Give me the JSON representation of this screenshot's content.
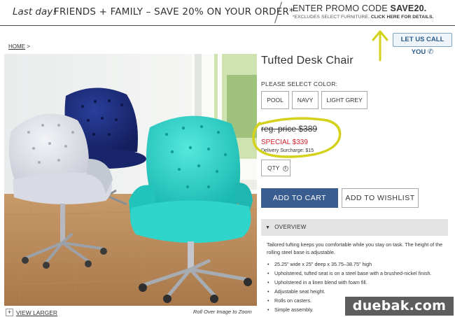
{
  "banner": {
    "last_day": "Last day!",
    "offer": "FRIENDS + FAMILY – SAVE 20% ON YOUR ORDER*",
    "enter_promo_prefix": "ENTER PROMO CODE ",
    "promo_code": "SAVE20.",
    "exclusions": "*EXCLUDES SELECT FURNITURE. ",
    "details_link": "CLICK HERE FOR DETAILS."
  },
  "call_us": {
    "label": "LET US CALL YOU",
    "icon": "phone-icon"
  },
  "breadcrumb": {
    "home": "HOME",
    "separator": ">"
  },
  "image": {
    "view_larger": "VIEW LARGER",
    "rollover_hint": "Roll Over Image to Zoom"
  },
  "product": {
    "title": "Tufted Desk Chair",
    "color_label": "PLEASE SELECT COLOR:",
    "colors": [
      "POOL",
      "NAVY",
      "LIGHT GREY"
    ],
    "regular_price": "reg. price $389",
    "special_price": "SPECIAL $339",
    "delivery_surcharge": "Delivery Surcharge: $15",
    "qty_label": "QTY",
    "add_to_cart": "ADD TO CART",
    "add_to_wishlist": "ADD TO WISHLIST"
  },
  "overview": {
    "heading": "OVERVIEW",
    "description": "Tailored tufting keeps you comfortable while you stay on task. The height of the rolling steel base is adjustable.",
    "bullets": [
      "25.25\" wide x 25\" deep x 35.75–38.75\" high",
      "Upholstered, tufted seat is on a steel base with a brushed-nickel finish.",
      "Upholstered in a linen blend with foam fill.",
      "Adjustable seat height.",
      "Rolls on casters.",
      "Simple assembly."
    ]
  },
  "watermark": "duebak.com",
  "colors": {
    "accent_blue": "#3a5d8f",
    "special_red": "#d0202e",
    "annotation_yellow": "#d4d21c"
  }
}
